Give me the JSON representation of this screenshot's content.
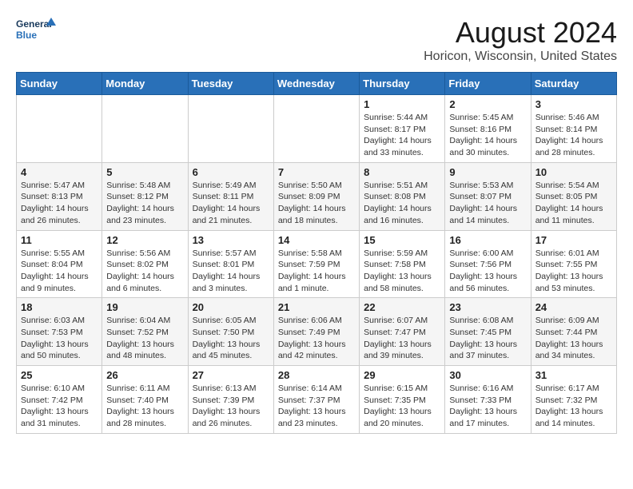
{
  "header": {
    "logo_line1": "General",
    "logo_line2": "Blue",
    "title": "August 2024",
    "subtitle": "Horicon, Wisconsin, United States"
  },
  "days_of_week": [
    "Sunday",
    "Monday",
    "Tuesday",
    "Wednesday",
    "Thursday",
    "Friday",
    "Saturday"
  ],
  "weeks": [
    [
      {
        "day": "",
        "detail": ""
      },
      {
        "day": "",
        "detail": ""
      },
      {
        "day": "",
        "detail": ""
      },
      {
        "day": "",
        "detail": ""
      },
      {
        "day": "1",
        "detail": "Sunrise: 5:44 AM\nSunset: 8:17 PM\nDaylight: 14 hours\nand 33 minutes."
      },
      {
        "day": "2",
        "detail": "Sunrise: 5:45 AM\nSunset: 8:16 PM\nDaylight: 14 hours\nand 30 minutes."
      },
      {
        "day": "3",
        "detail": "Sunrise: 5:46 AM\nSunset: 8:14 PM\nDaylight: 14 hours\nand 28 minutes."
      }
    ],
    [
      {
        "day": "4",
        "detail": "Sunrise: 5:47 AM\nSunset: 8:13 PM\nDaylight: 14 hours\nand 26 minutes."
      },
      {
        "day": "5",
        "detail": "Sunrise: 5:48 AM\nSunset: 8:12 PM\nDaylight: 14 hours\nand 23 minutes."
      },
      {
        "day": "6",
        "detail": "Sunrise: 5:49 AM\nSunset: 8:11 PM\nDaylight: 14 hours\nand 21 minutes."
      },
      {
        "day": "7",
        "detail": "Sunrise: 5:50 AM\nSunset: 8:09 PM\nDaylight: 14 hours\nand 18 minutes."
      },
      {
        "day": "8",
        "detail": "Sunrise: 5:51 AM\nSunset: 8:08 PM\nDaylight: 14 hours\nand 16 minutes."
      },
      {
        "day": "9",
        "detail": "Sunrise: 5:53 AM\nSunset: 8:07 PM\nDaylight: 14 hours\nand 14 minutes."
      },
      {
        "day": "10",
        "detail": "Sunrise: 5:54 AM\nSunset: 8:05 PM\nDaylight: 14 hours\nand 11 minutes."
      }
    ],
    [
      {
        "day": "11",
        "detail": "Sunrise: 5:55 AM\nSunset: 8:04 PM\nDaylight: 14 hours\nand 9 minutes."
      },
      {
        "day": "12",
        "detail": "Sunrise: 5:56 AM\nSunset: 8:02 PM\nDaylight: 14 hours\nand 6 minutes."
      },
      {
        "day": "13",
        "detail": "Sunrise: 5:57 AM\nSunset: 8:01 PM\nDaylight: 14 hours\nand 3 minutes."
      },
      {
        "day": "14",
        "detail": "Sunrise: 5:58 AM\nSunset: 7:59 PM\nDaylight: 14 hours\nand 1 minute."
      },
      {
        "day": "15",
        "detail": "Sunrise: 5:59 AM\nSunset: 7:58 PM\nDaylight: 13 hours\nand 58 minutes."
      },
      {
        "day": "16",
        "detail": "Sunrise: 6:00 AM\nSunset: 7:56 PM\nDaylight: 13 hours\nand 56 minutes."
      },
      {
        "day": "17",
        "detail": "Sunrise: 6:01 AM\nSunset: 7:55 PM\nDaylight: 13 hours\nand 53 minutes."
      }
    ],
    [
      {
        "day": "18",
        "detail": "Sunrise: 6:03 AM\nSunset: 7:53 PM\nDaylight: 13 hours\nand 50 minutes."
      },
      {
        "day": "19",
        "detail": "Sunrise: 6:04 AM\nSunset: 7:52 PM\nDaylight: 13 hours\nand 48 minutes."
      },
      {
        "day": "20",
        "detail": "Sunrise: 6:05 AM\nSunset: 7:50 PM\nDaylight: 13 hours\nand 45 minutes."
      },
      {
        "day": "21",
        "detail": "Sunrise: 6:06 AM\nSunset: 7:49 PM\nDaylight: 13 hours\nand 42 minutes."
      },
      {
        "day": "22",
        "detail": "Sunrise: 6:07 AM\nSunset: 7:47 PM\nDaylight: 13 hours\nand 39 minutes."
      },
      {
        "day": "23",
        "detail": "Sunrise: 6:08 AM\nSunset: 7:45 PM\nDaylight: 13 hours\nand 37 minutes."
      },
      {
        "day": "24",
        "detail": "Sunrise: 6:09 AM\nSunset: 7:44 PM\nDaylight: 13 hours\nand 34 minutes."
      }
    ],
    [
      {
        "day": "25",
        "detail": "Sunrise: 6:10 AM\nSunset: 7:42 PM\nDaylight: 13 hours\nand 31 minutes."
      },
      {
        "day": "26",
        "detail": "Sunrise: 6:11 AM\nSunset: 7:40 PM\nDaylight: 13 hours\nand 28 minutes."
      },
      {
        "day": "27",
        "detail": "Sunrise: 6:13 AM\nSunset: 7:39 PM\nDaylight: 13 hours\nand 26 minutes."
      },
      {
        "day": "28",
        "detail": "Sunrise: 6:14 AM\nSunset: 7:37 PM\nDaylight: 13 hours\nand 23 minutes."
      },
      {
        "day": "29",
        "detail": "Sunrise: 6:15 AM\nSunset: 7:35 PM\nDaylight: 13 hours\nand 20 minutes."
      },
      {
        "day": "30",
        "detail": "Sunrise: 6:16 AM\nSunset: 7:33 PM\nDaylight: 13 hours\nand 17 minutes."
      },
      {
        "day": "31",
        "detail": "Sunrise: 6:17 AM\nSunset: 7:32 PM\nDaylight: 13 hours\nand 14 minutes."
      }
    ]
  ]
}
